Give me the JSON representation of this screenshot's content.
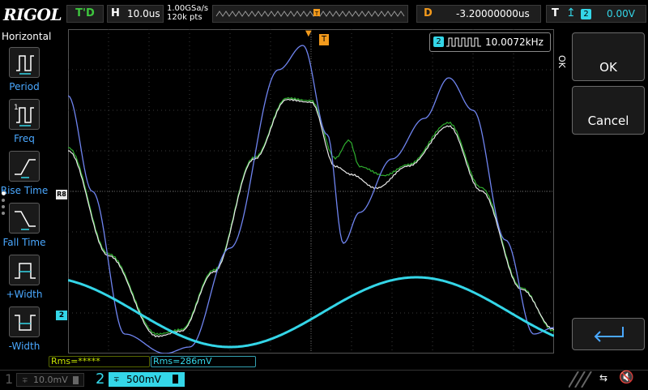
{
  "topbar": {
    "logo": "RIGOL",
    "trigger_status": "T'D",
    "timebase_label": "H",
    "timebase_value": "10.0us",
    "sample_rate": "1.00GSa/s",
    "memory_depth": "120k pts",
    "delay_label": "D",
    "delay_value": "-3.20000000us",
    "trigger_label": "T",
    "trigger_source": "2",
    "trigger_level": "0.00V"
  },
  "left_panel": {
    "title": "Horizontal",
    "items": [
      {
        "label": "Period",
        "icon": "period-icon"
      },
      {
        "label": "Freq",
        "icon": "freq-icon"
      },
      {
        "label": "Rise Time",
        "icon": "rise-time-icon"
      },
      {
        "label": "Fall Time",
        "icon": "fall-time-icon"
      },
      {
        "label": "+Width",
        "icon": "positive-width-icon"
      },
      {
        "label": "-Width",
        "icon": "negative-width-icon"
      }
    ]
  },
  "frequency_counter": {
    "channel": "2",
    "value": "10.0072kHz"
  },
  "markers": {
    "trigger_pos": "T",
    "ref": "R8",
    "ch2": "2",
    "trigger_level": "T"
  },
  "measurements": [
    {
      "text": "Rms=*****"
    },
    {
      "text": "Rms=286mV"
    }
  ],
  "right_panel": {
    "side_label": "OK",
    "ok": "OK",
    "cancel": "Cancel",
    "enter_icon": "enter-icon"
  },
  "bottombar": {
    "ch1_number": "1",
    "ch1_scale": "10.0mV",
    "ch2_number": "2",
    "ch2_scale": "500mV",
    "usb_icon": "⇆",
    "sound_icon": "🔇"
  },
  "colors": {
    "ch2": "#34d6e8",
    "trigger": "#f39a1c",
    "ref_green": "#2fae2f",
    "ref_white": "#e8e8e8",
    "ref_blue": "#6f84f0",
    "label_blue": "#4aa8ff"
  }
}
